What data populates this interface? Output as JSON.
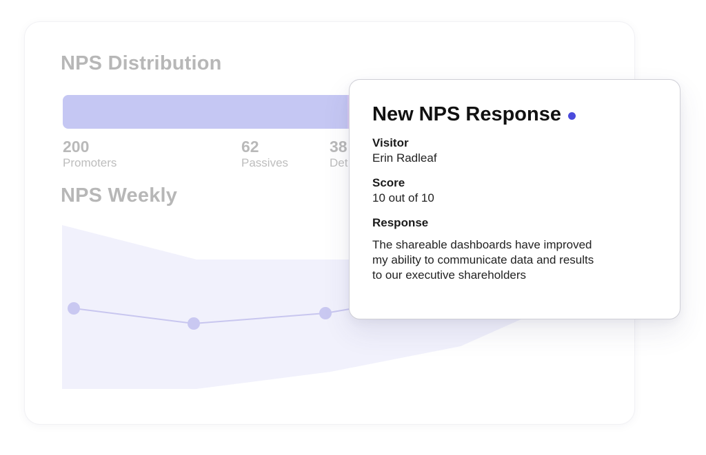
{
  "distribution": {
    "title": "NPS Distribution",
    "segments": [
      {
        "name": "promoters",
        "value": 200,
        "label": "Promoters",
        "color": "#c5c7f3"
      },
      {
        "name": "passives",
        "value": 62,
        "label": "Passives",
        "color": "#dccbf5"
      },
      {
        "name": "detractors",
        "value": 38,
        "label": "Det",
        "color": "#efc9dc"
      }
    ]
  },
  "weekly": {
    "title": "NPS Weekly",
    "area_color": "#f1f1fc",
    "line_color": "#c8c6ef",
    "point_color": "#c9c8f1"
  },
  "popup": {
    "title": "New NPS Response",
    "dot_color": "#4b4bdc",
    "visitor_label": "Visitor",
    "visitor_value": "Erin Radleaf",
    "score_label": "Score",
    "score_value": "10 out of 10",
    "response_label": "Response",
    "response_lines": [
      "The shareable dashboards have improved",
      "my ability to communicate data and results",
      "to our executive shareholders"
    ]
  }
}
